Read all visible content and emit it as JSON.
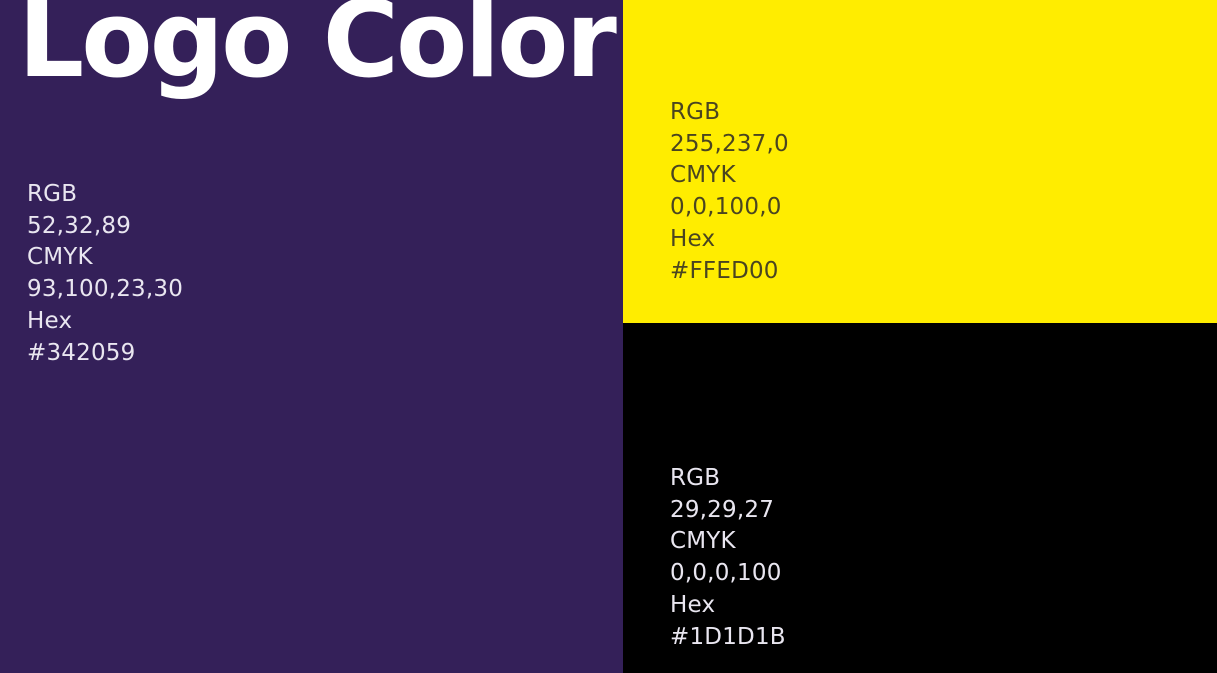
{
  "title": "Logo Color",
  "colors": {
    "purple": "#342059",
    "yellow": "#FFED00",
    "black": "#000000",
    "light_text": "#E9E6F0",
    "dark_text": "#4A4520"
  },
  "swatches": [
    {
      "name": "purple",
      "rgb_label": "RGB",
      "rgb_value": "52,32,89",
      "cmyk_label": "CMYK",
      "cmyk_value": "93,100,23,30",
      "hex_label": "Hex",
      "hex_value": "#342059"
    },
    {
      "name": "yellow",
      "rgb_label": "RGB",
      "rgb_value": "255,237,0",
      "cmyk_label": "CMYK",
      "cmyk_value": "0,0,100,0",
      "hex_label": "Hex",
      "hex_value": "#FFED00"
    },
    {
      "name": "black",
      "rgb_label": "RGB",
      "rgb_value": "29,29,27",
      "cmyk_label": "CMYK",
      "cmyk_value": "0,0,0,100",
      "hex_label": "Hex",
      "hex_value": "#1D1D1B"
    }
  ]
}
